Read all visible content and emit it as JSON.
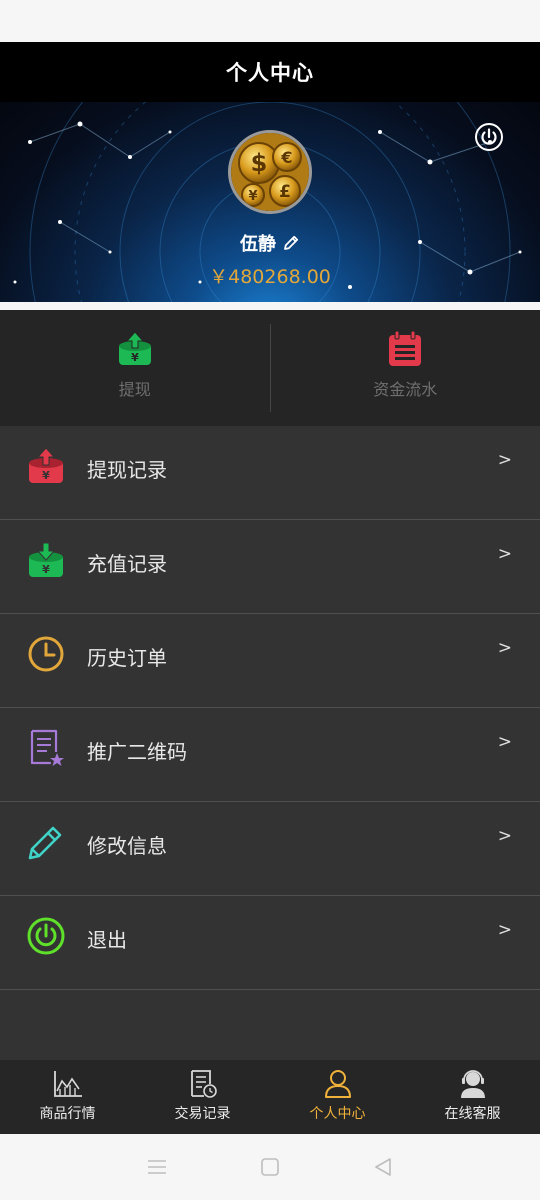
{
  "header": {
    "title": "个人中心"
  },
  "profile": {
    "name": "伍静",
    "balance": "￥480268.00",
    "avatar_icon": "currency-coins-icon",
    "edit_icon": "pencil-icon",
    "logout_icon": "power-icon"
  },
  "quick_actions": [
    {
      "label": "提现",
      "icon": "withdraw-icon",
      "color": "#1db954"
    },
    {
      "label": "资金流水",
      "icon": "ledger-icon",
      "color": "#e23a4a"
    }
  ],
  "menu": [
    {
      "label": "提现记录",
      "arrow": ">",
      "icon": "withdraw-record-icon",
      "color": "#e23a4a"
    },
    {
      "label": "充值记录",
      "arrow": ">",
      "icon": "recharge-record-icon",
      "color": "#1db954"
    },
    {
      "label": "历史订单",
      "arrow": ">",
      "icon": "clock-icon",
      "color": "#e2a73a"
    },
    {
      "label": "推广二维码",
      "arrow": ">",
      "icon": "document-star-icon",
      "color": "#a77ad8"
    },
    {
      "label": "修改信息",
      "arrow": ">",
      "icon": "pencil-icon",
      "color": "#3fd4c8"
    },
    {
      "label": "退出",
      "arrow": ">",
      "icon": "power-icon",
      "color": "#5fe02a"
    }
  ],
  "tabs": [
    {
      "label": "商品行情",
      "icon": "chart-icon",
      "active": false
    },
    {
      "label": "交易记录",
      "icon": "document-clock-icon",
      "active": false
    },
    {
      "label": "个人中心",
      "icon": "user-icon",
      "active": true
    },
    {
      "label": "在线客服",
      "icon": "headset-user-icon",
      "active": false
    }
  ],
  "colors": {
    "accent": "#f0b23a",
    "balance": "#e2a73a",
    "background": "#333333"
  }
}
